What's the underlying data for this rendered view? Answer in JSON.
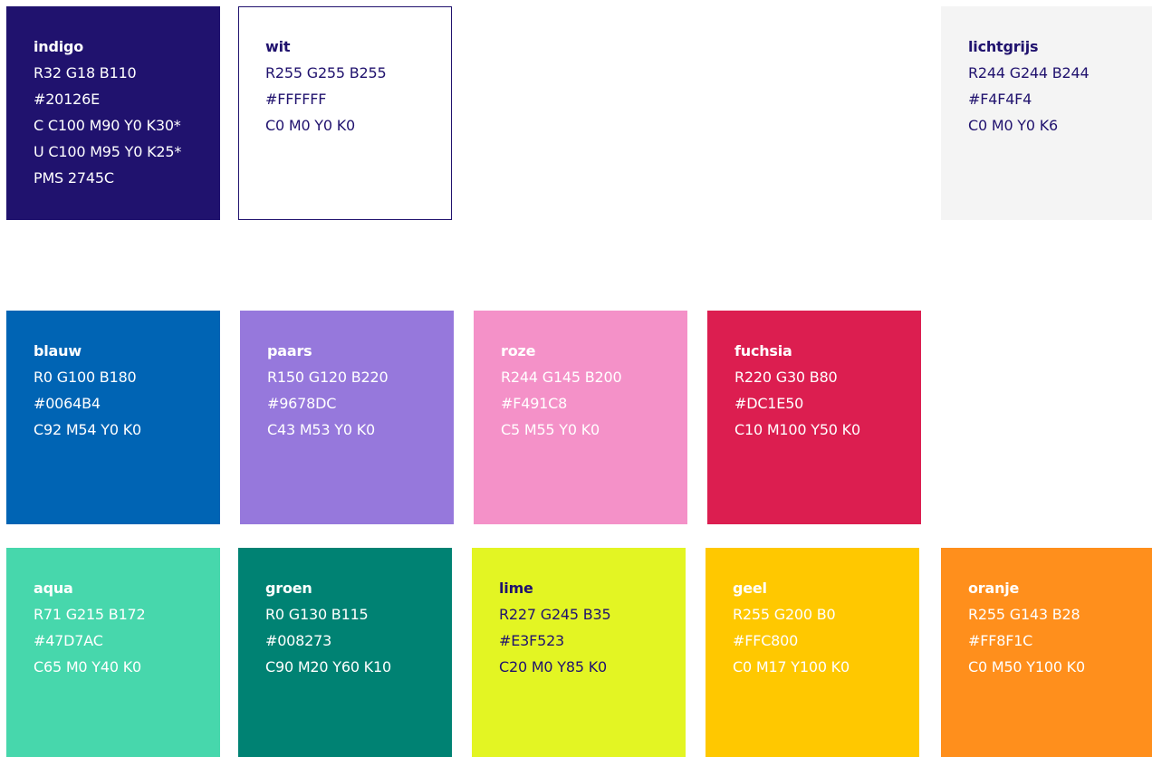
{
  "swatches": [
    {
      "name": "indigo",
      "lines": [
        "R32 G18 B110",
        "#20126E",
        "C C100 M90 Y0 K30*",
        "U C100 M95 Y0 K25*",
        "PMS 2745C"
      ],
      "color": "#20126E",
      "text_color": "#FFFFFF"
    },
    {
      "name": "wit",
      "lines": [
        "R255 G255 B255",
        "#FFFFFF",
        "C0 M0 Y0 K0"
      ],
      "color": "#FFFFFF",
      "text_color": "#20126E"
    },
    {
      "name": "lichtgrijs",
      "lines": [
        "R244 G244 B244",
        "#F4F4F4",
        "C0 M0 Y0 K6"
      ],
      "color": "#F4F4F4",
      "text_color": "#20126E"
    },
    {
      "name": "blauw",
      "lines": [
        "R0 G100 B180",
        "#0064B4",
        "C92 M54 Y0 K0"
      ],
      "color": "#0064B4",
      "text_color": "#FFFFFF"
    },
    {
      "name": "paars",
      "lines": [
        "R150 G120 B220",
        "#9678DC",
        "C43 M53 Y0 K0"
      ],
      "color": "#9678DC",
      "text_color": "#FFFFFF"
    },
    {
      "name": "roze",
      "lines": [
        "R244 G145 B200",
        "#F491C8",
        "C5 M55 Y0 K0"
      ],
      "color": "#F491C8",
      "text_color": "#FFFFFF"
    },
    {
      "name": "fuchsia",
      "lines": [
        "R220 G30 B80",
        "#DC1E50",
        "C10 M100 Y50 K0"
      ],
      "color": "#DC1E50",
      "text_color": "#FFFFFF"
    },
    {
      "name": "aqua",
      "lines": [
        "R71 G215 B172",
        "#47D7AC",
        "C65 M0 Y40 K0"
      ],
      "color": "#47D7AC",
      "text_color": "#FFFFFF"
    },
    {
      "name": "groen",
      "lines": [
        "R0 G130 B115",
        "#008273",
        "C90 M20 Y60 K10"
      ],
      "color": "#008273",
      "text_color": "#FFFFFF"
    },
    {
      "name": "lime",
      "lines": [
        "R227 G245 B35",
        "#E3F523",
        "C20 M0 Y85 K0"
      ],
      "color": "#E3F523",
      "text_color": "#20126E"
    },
    {
      "name": "geel",
      "lines": [
        "R255 G200 B0",
        "#FFC800",
        "C0 M17 Y100 K0"
      ],
      "color": "#FFC800",
      "text_color": "#FFFFFF"
    },
    {
      "name": "oranje",
      "lines": [
        "R255 G143 B28",
        "#FF8F1C",
        "C0 M50 Y100 K0"
      ],
      "color": "#FF8F1C",
      "text_color": "#FFFFFF"
    }
  ]
}
